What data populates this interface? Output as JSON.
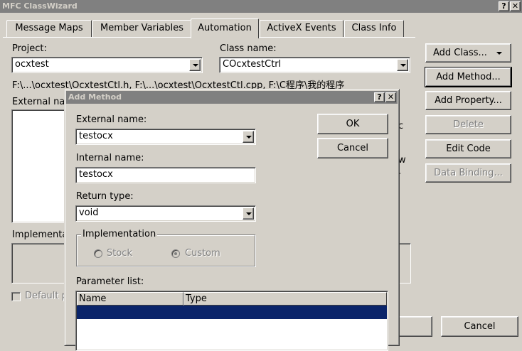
{
  "main_window": {
    "title": "MFC ClassWizard",
    "help_btn": "?",
    "close_btn": "✕",
    "tabs": [
      {
        "label": "Message Maps"
      },
      {
        "label": "Member Variables"
      },
      {
        "label": "Automation",
        "active": true
      },
      {
        "label": "ActiveX Events"
      },
      {
        "label": "Class Info"
      }
    ],
    "project_label": "Project:",
    "project_value": "ocxtest",
    "class_name_label": "Class name:",
    "class_name_value": "COcxtestCtrl",
    "path_text": "F:\\...\\ocxtest\\OcxtestCtl.h, F:\\...\\ocxtest\\OcxtestCtl.cpp, F:\\C程序\\我的程序",
    "external_names_label": "External na",
    "implementation_label": "Implementa",
    "default_property_label": "Default p",
    "side_partial_1": "c",
    "side_partial_2": "w",
    "side_partial_3": ".",
    "buttons": {
      "add_class": "Add Class...",
      "add_method": "Add Method...",
      "add_property": "Add Property...",
      "delete": "Delete",
      "edit_code": "Edit Code",
      "data_binding": "Data Binding...",
      "cancel": "Cancel"
    }
  },
  "dialog": {
    "title": "Add Method",
    "help_btn": "?",
    "close_btn": "✕",
    "external_name_label": "External name:",
    "external_name_value": "testocx",
    "internal_name_label": "Internal name:",
    "internal_name_value": "testocx",
    "return_type_label": "Return type:",
    "return_type_value": "void",
    "implementation_group": "Implementation",
    "stock_label": "Stock",
    "custom_label": "Custom",
    "parameter_list_label": "Parameter list:",
    "columns": [
      "Name",
      "Type"
    ],
    "ok": "OK",
    "cancel": "Cancel"
  },
  "colors": {
    "face": "#d4d0c8",
    "inactive_title": "#808080",
    "selection": "#0a246a"
  }
}
